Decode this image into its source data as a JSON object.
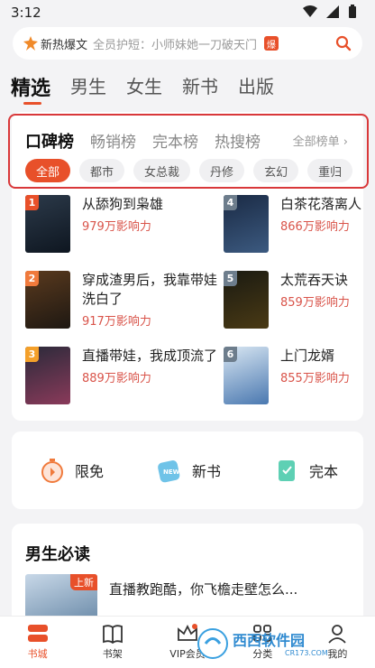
{
  "status": {
    "time": "3:12"
  },
  "search": {
    "tag": "新热爆文",
    "hint": "全员护短：小师妹她一刀破天门",
    "badge": "爆"
  },
  "channels": [
    "精选",
    "男生",
    "女生",
    "新书",
    "出版"
  ],
  "rank": {
    "tabs": [
      "口碑榜",
      "畅销榜",
      "完本榜",
      "热搜榜"
    ],
    "all_label": "全部榜单",
    "genres": [
      "全部",
      "都市",
      "女总裁",
      "丹修",
      "玄幻",
      "重归"
    ],
    "books": [
      {
        "rank": "1",
        "title": "从舔狗到枭雄",
        "heat": "979万影响力",
        "rank_color": "#e8502a"
      },
      {
        "rank": "4",
        "title": "白茶花落离人",
        "heat": "866万影响力",
        "rank_color": "#6d7d8c"
      },
      {
        "rank": "2",
        "title": "穿成渣男后，我靠带娃洗白了",
        "heat": "917万影响力",
        "rank_color": "#f07a3c"
      },
      {
        "rank": "5",
        "title": "太荒吞天诀",
        "heat": "859万影响力",
        "rank_color": "#6d7d8c"
      },
      {
        "rank": "3",
        "title": "直播带娃，我成顶流了",
        "heat": "889万影响力",
        "rank_color": "#f4a02a"
      },
      {
        "rank": "6",
        "title": "上门龙婿",
        "heat": "855万影响力",
        "rank_color": "#6d7d8c"
      }
    ]
  },
  "quick": [
    {
      "label": "限免",
      "icon": "stopwatch-icon"
    },
    {
      "label": "新书",
      "icon": "new-badge-icon"
    },
    {
      "label": "完本",
      "icon": "book-complete-icon"
    }
  ],
  "must_read": {
    "title": "男生必读",
    "badge": "上新",
    "book_title": "直播教跑酷，你飞檐走壁怎么..."
  },
  "bottom_nav": [
    "书城",
    "书架",
    "VIP会员",
    "分类",
    "我的"
  ],
  "watermark": {
    "title": "西西软件园",
    "url": "CR173.COM"
  },
  "colors": {
    "accent": "#e8502a",
    "heat": "#d9544a"
  }
}
